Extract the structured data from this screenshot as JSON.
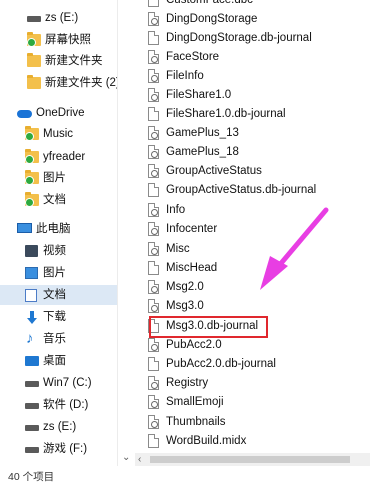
{
  "nav": {
    "items": [
      {
        "label": "zs (E:)",
        "icon": "drive-icon"
      },
      {
        "label": "屏幕快照",
        "icon": "folder-synced-icon"
      },
      {
        "label": "新建文件夹",
        "icon": "folder-icon"
      },
      {
        "label": "新建文件夹 (2)",
        "icon": "folder-icon"
      },
      {
        "label": "OneDrive",
        "icon": "onedrive-cloud-icon"
      },
      {
        "label": "Music",
        "icon": "folder-synced-icon"
      },
      {
        "label": "yfreader",
        "icon": "folder-synced-icon"
      },
      {
        "label": "图片",
        "icon": "folder-synced-icon"
      },
      {
        "label": "文档",
        "icon": "folder-synced-icon"
      },
      {
        "label": "此电脑",
        "icon": "this-pc-icon"
      },
      {
        "label": "视频",
        "icon": "video-folder-icon"
      },
      {
        "label": "图片",
        "icon": "pictures-folder-icon"
      },
      {
        "label": "文档",
        "icon": "documents-folder-icon"
      },
      {
        "label": "下载",
        "icon": "download-icon"
      },
      {
        "label": "音乐",
        "icon": "music-icon"
      },
      {
        "label": "桌面",
        "icon": "desktop-icon"
      },
      {
        "label": "Win7 (C:)",
        "icon": "drive-icon"
      },
      {
        "label": "软件 (D:)",
        "icon": "drive-icon"
      },
      {
        "label": "zs (E:)",
        "icon": "drive-icon"
      },
      {
        "label": "游戏 (F:)",
        "icon": "drive-icon"
      }
    ],
    "selected_label": "文档"
  },
  "files": [
    {
      "name": "CustomFace.dbc",
      "icon": "file-icon"
    },
    {
      "name": "DingDongStorage",
      "icon": "settings-file-icon"
    },
    {
      "name": "DingDongStorage.db-journal",
      "icon": "file-icon"
    },
    {
      "name": "FaceStore",
      "icon": "settings-file-icon"
    },
    {
      "name": "FileInfo",
      "icon": "settings-file-icon"
    },
    {
      "name": "FileShare1.0",
      "icon": "settings-file-icon"
    },
    {
      "name": "FileShare1.0.db-journal",
      "icon": "file-icon"
    },
    {
      "name": "GamePlus_13",
      "icon": "settings-file-icon"
    },
    {
      "name": "GamePlus_18",
      "icon": "settings-file-icon"
    },
    {
      "name": "GroupActiveStatus",
      "icon": "settings-file-icon"
    },
    {
      "name": "GroupActiveStatus.db-journal",
      "icon": "file-icon"
    },
    {
      "name": "Info",
      "icon": "settings-file-icon"
    },
    {
      "name": "Infocenter",
      "icon": "settings-file-icon"
    },
    {
      "name": "Misc",
      "icon": "settings-file-icon"
    },
    {
      "name": "MiscHead",
      "icon": "file-icon"
    },
    {
      "name": "Msg2.0",
      "icon": "settings-file-icon"
    },
    {
      "name": "Msg3.0",
      "icon": "settings-file-icon"
    },
    {
      "name": "Msg3.0.db-journal",
      "icon": "file-icon"
    },
    {
      "name": "PubAcc2.0",
      "icon": "settings-file-icon"
    },
    {
      "name": "PubAcc2.0.db-journal",
      "icon": "file-icon"
    },
    {
      "name": "Registry",
      "icon": "settings-file-icon"
    },
    {
      "name": "SmallEmoji",
      "icon": "settings-file-icon"
    },
    {
      "name": "Thumbnails",
      "icon": "settings-file-icon"
    },
    {
      "name": "WordBuild.midx",
      "icon": "file-icon"
    }
  ],
  "highlighted_file": "Msg3.0.db-journal",
  "annotation": {
    "arrow_color": "#e83ee3",
    "box_color": "#e0282e"
  },
  "status": {
    "item_count": "40 个项目"
  },
  "colors": {
    "selection": "#dce8f5",
    "accent": "#1f78d1"
  }
}
